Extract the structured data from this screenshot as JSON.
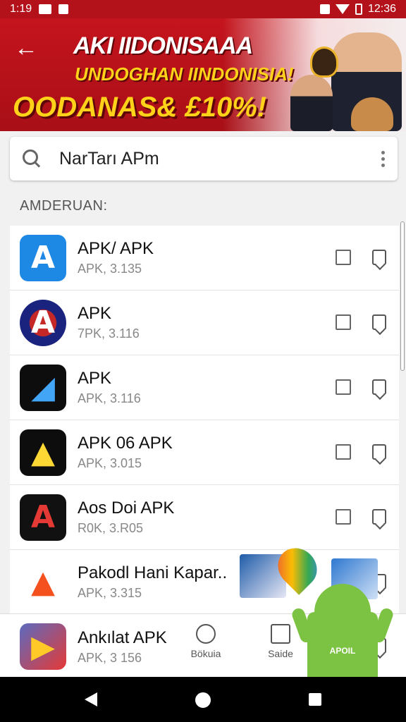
{
  "status_bar": {
    "time_left": "1:19",
    "time_right": "12:36"
  },
  "banner": {
    "back_icon": "arrow-left-icon",
    "line1": "AKI IIDONISAAA",
    "line2": "UNDOGHAN IINDONISIA!",
    "line3": "OODANAS& £10%!"
  },
  "search": {
    "icon": "search-icon",
    "value": "NarTarı APm",
    "more_icon": "more-vert-icon"
  },
  "section_label": "AMDERUAN:",
  "apps": [
    {
      "name": "APK/ APK",
      "sub": "APK, 3.135",
      "icon_color": "#1e88e5",
      "icon_bg": "#1e88e5",
      "glyph": "A",
      "glyph_color": "#ffffff"
    },
    {
      "name": "APK",
      "sub": "7PK, 3.116",
      "icon_color": "#c62828",
      "icon_bg": "#1a237e",
      "glyph": "A",
      "glyph_color": "#ffffff"
    },
    {
      "name": "APK",
      "sub": "APK, 3.116",
      "icon_color": "#1976d2",
      "icon_bg": "#0d0d0d",
      "glyph": "◢",
      "glyph_color": "#42a5f5"
    },
    {
      "name": "APK 06 APK",
      "sub": "APK, 3.015",
      "icon_color": "#fbc02d",
      "icon_bg": "#0d0d0d",
      "glyph": "▲",
      "glyph_color": "#fdd835"
    },
    {
      "name": "Aos Doi APK",
      "sub": "R0K, 3.R05",
      "icon_color": "#d32f2f",
      "icon_bg": "#111111",
      "glyph": "A",
      "glyph_color": "#e53935"
    },
    {
      "name": "Pakodl Hani Kapar..",
      "sub": "APK, 3.315",
      "icon_color": "#f4511e",
      "icon_bg": "#ffffff",
      "glyph": "▲",
      "glyph_color": "#f4511e"
    }
  ],
  "bottom_app": {
    "name": "Ankılat APK",
    "sub": "APK, 3 156",
    "icon_bg": "#5c6bc0",
    "glyph": "▶",
    "glyph_color": "#ffca28"
  },
  "bottom_nav": [
    {
      "label": "Bökuia",
      "icon": "compass-icon"
    },
    {
      "label": "Saide",
      "icon": "share-icon"
    }
  ],
  "promo": {
    "label": "APOIL"
  },
  "system_nav": {
    "back": "back-triangle-icon",
    "home": "home-circle-icon",
    "recent": "recent-square-icon"
  }
}
